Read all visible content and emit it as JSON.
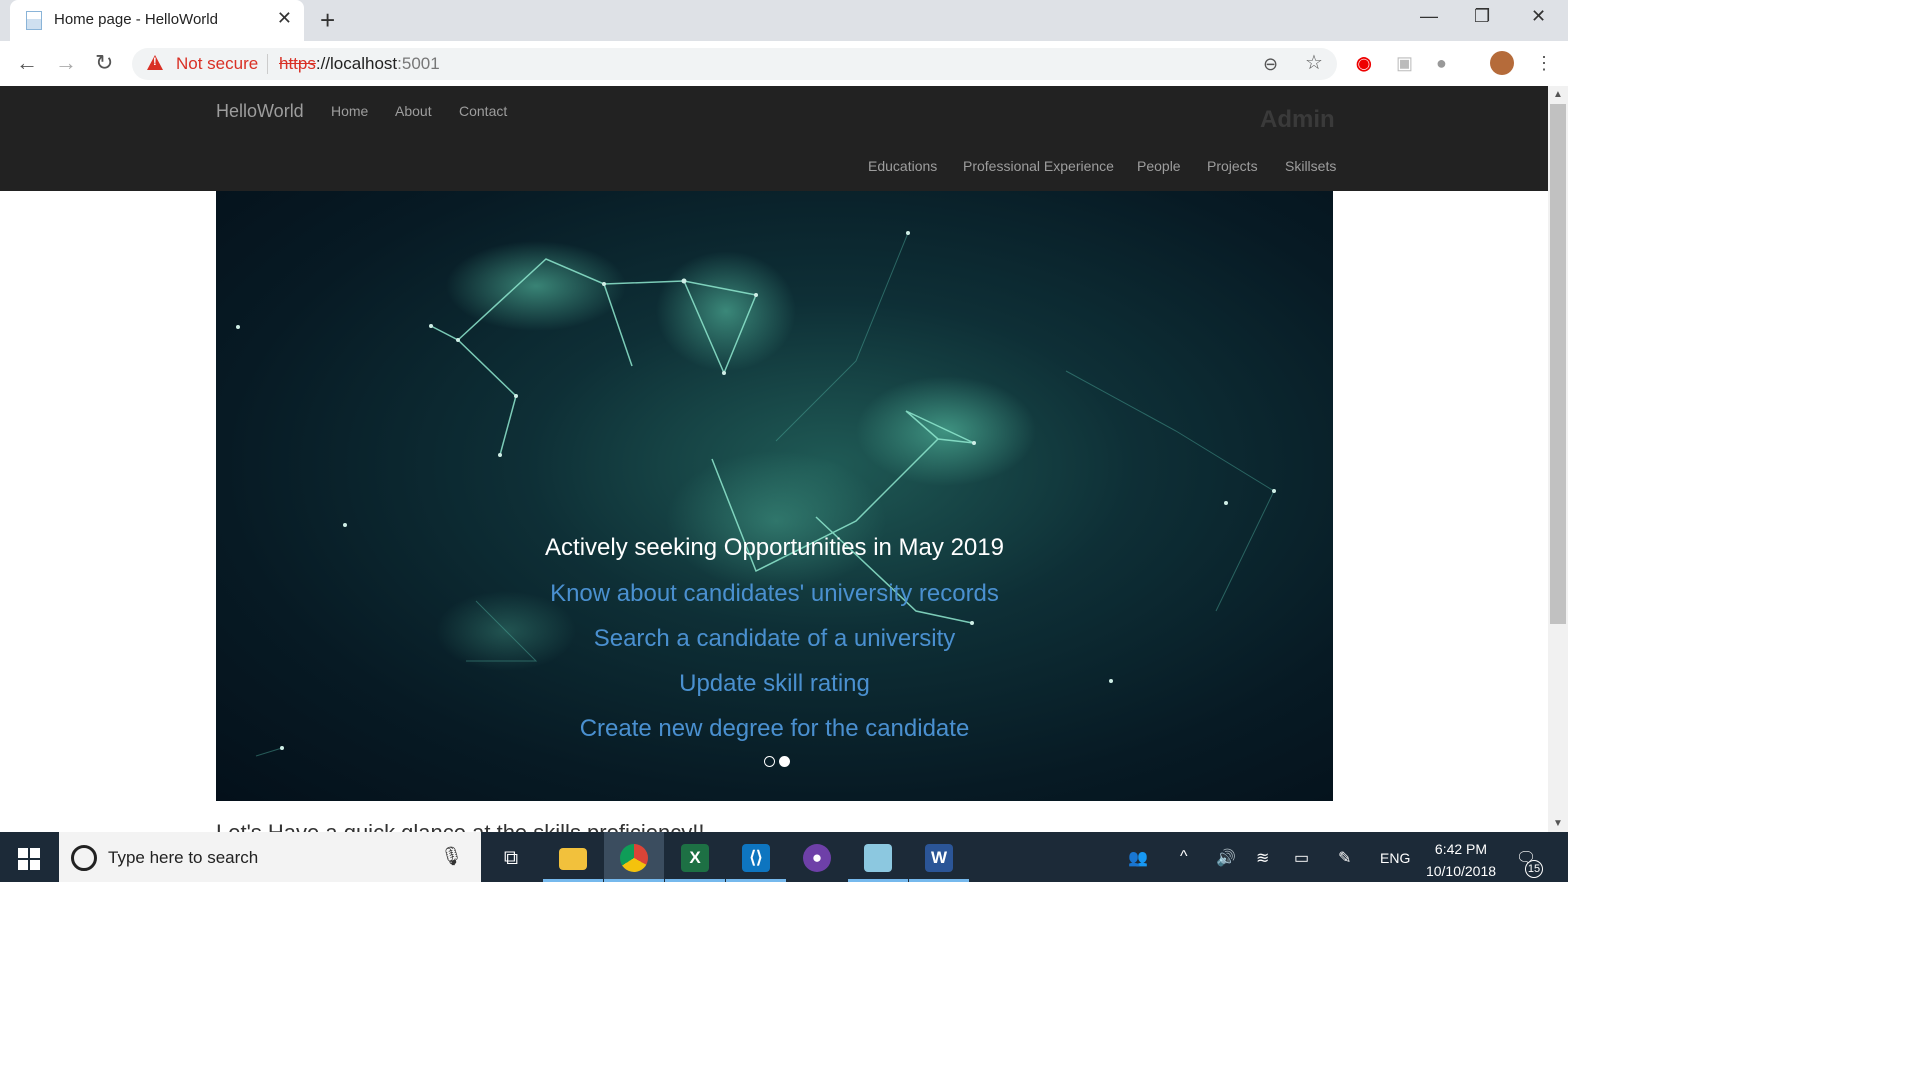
{
  "browser": {
    "tab_title": "Home page - HelloWorld",
    "security_label": "Not secure",
    "url_protocol": "https",
    "url_sep": "://",
    "url_host": "localhost",
    "url_port": ":5001"
  },
  "navbar": {
    "brand": "HelloWorld",
    "links": [
      "Home",
      "About",
      "Contact"
    ],
    "admin": "Admin",
    "admin_links": [
      "Educations",
      "Professional Experience",
      "People",
      "Projects",
      "Skillsets"
    ]
  },
  "hero": {
    "headline": "Actively seeking Opportunities in May 2019",
    "links": [
      "Know about candidates' university records",
      "Search a candidate of a university",
      "Update skill rating",
      "Create new degree for the candidate"
    ],
    "carousel_slides": 2,
    "active_slide": 2
  },
  "content": {
    "section_heading": "Let's Have a quick glance at the skills proficiency!!"
  },
  "taskbar": {
    "search_placeholder": "Type here to search",
    "language": "ENG",
    "time": "6:42 PM",
    "date": "10/10/2018",
    "notification_count": "15"
  },
  "colors": {
    "navbar_bg": "#222222",
    "link_blue": "#4a90d0",
    "warning_red": "#d93025",
    "taskbar_bg": "#1c2a38"
  }
}
